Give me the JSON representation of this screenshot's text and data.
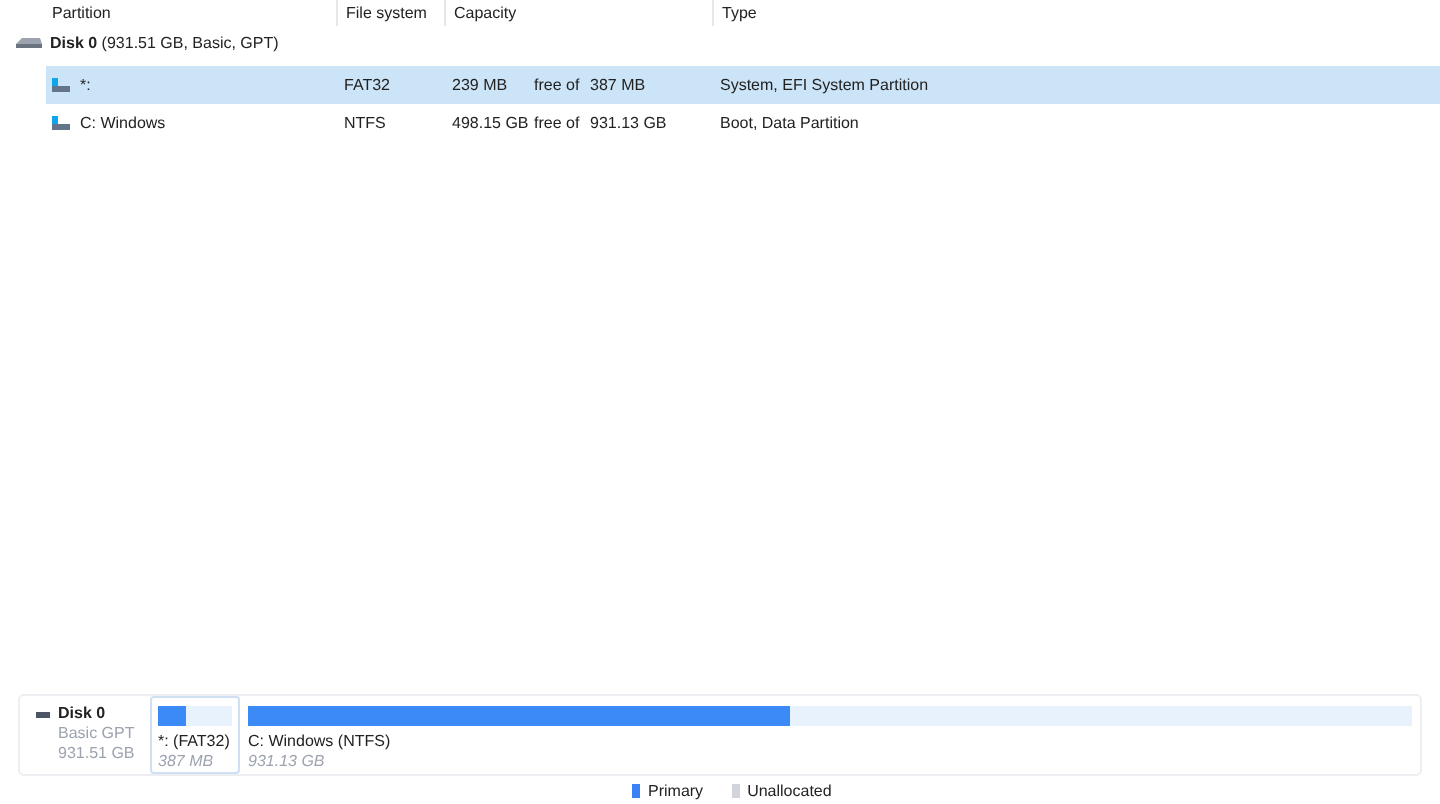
{
  "table": {
    "columns": [
      "Partition",
      "File system",
      "Capacity",
      "Type"
    ],
    "disk": {
      "name": "Disk 0",
      "details": "(931.51 GB, Basic, GPT)"
    },
    "rows": [
      {
        "name": "*:",
        "file_system": "FAT32",
        "free": "239 MB",
        "free_of": "free of",
        "total": "387 MB",
        "type": "System, EFI System Partition",
        "selected": true
      },
      {
        "name": "C: Windows",
        "file_system": "NTFS",
        "free": "498.15 GB",
        "free_of": "free of",
        "total": "931.13 GB",
        "type": "Boot, Data Partition",
        "selected": false
      }
    ]
  },
  "disk_map": {
    "disk": {
      "name": "Disk 0",
      "style": "Basic GPT",
      "size": "931.51 GB"
    },
    "partitions": [
      {
        "label": "*: (FAT32)",
        "size": "387 MB",
        "level": 0.38,
        "selected": true
      },
      {
        "label": "C: Windows (NTFS)",
        "size": "931.13 GB",
        "level": 0.466,
        "selected": false
      }
    ],
    "legend": [
      {
        "label": "Primary",
        "color": "#3b82f6"
      },
      {
        "label": "Unallocated",
        "color": "#d1d5db"
      }
    ]
  }
}
